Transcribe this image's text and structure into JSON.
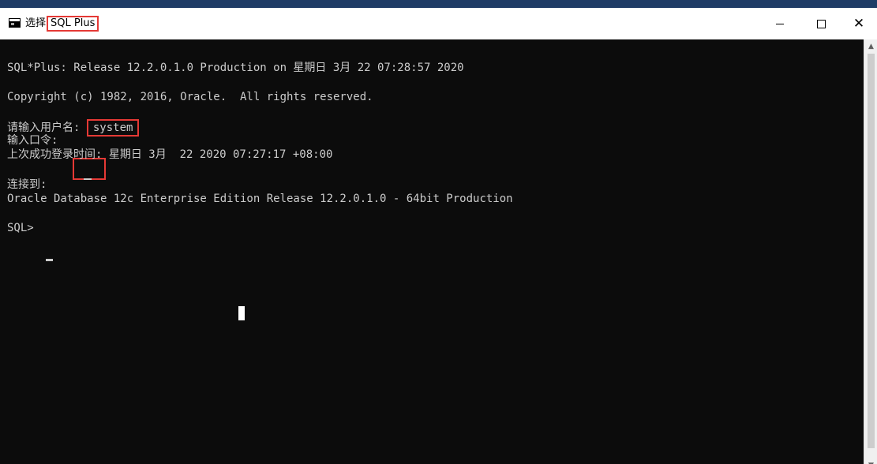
{
  "window": {
    "title_prefix": "选择",
    "app_name": "SQL Plus",
    "controls": {
      "minimize": "—",
      "maximize": "☐",
      "close": "✕"
    }
  },
  "console": {
    "banner": "SQL*Plus: Release 12.2.0.1.0 Production on 星期日 3月 22 07:28:57 2020",
    "copyright": "Copyright (c) 1982, 2016, Oracle.  All rights reserved.",
    "username_prompt": "请输入用户名:",
    "username_value": "system",
    "password_prompt": "输入口令:",
    "last_login": "上次成功登录时间: 星期日 3月  22 2020 07:27:17 +08:00",
    "connected_to": "连接到:",
    "database": "Oracle Database 12c Enterprise Edition Release 12.2.0.1.0 - 64bit Production",
    "sql_prompt": "SQL> "
  },
  "colors": {
    "console_bg": "#0c0c0c",
    "console_text": "#cccccc",
    "highlight": "#e53935"
  },
  "icons": {
    "app": "console-window-icon",
    "scroll_up": "▲",
    "scroll_down": "▼"
  }
}
